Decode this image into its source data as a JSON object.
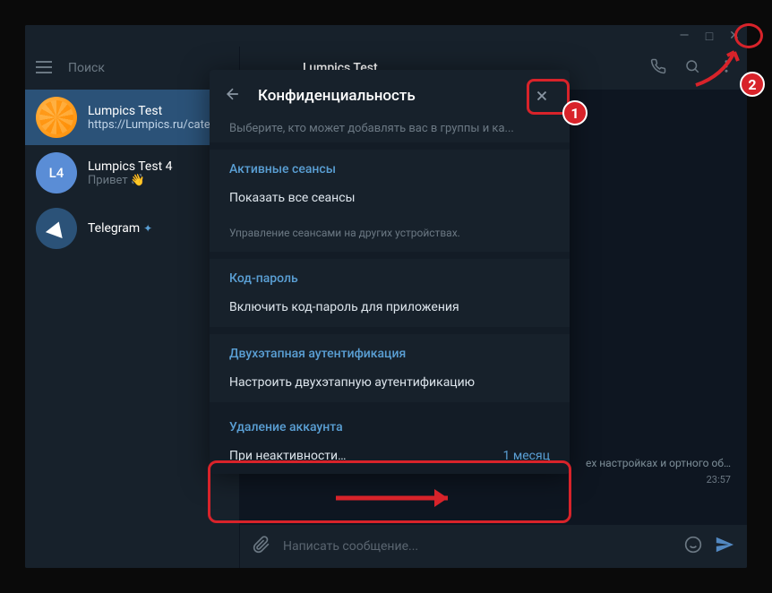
{
  "titlebar": {
    "minimize": "—",
    "maximize": "□",
    "close": "✕"
  },
  "sidebar": {
    "search_placeholder": "Поиск",
    "chats": [
      {
        "title": "Lumpics Test",
        "subtitle": "https://Lumpics.ru/cate...",
        "avatar_label": ""
      },
      {
        "title": "Lumpics Test 4",
        "subtitle": "Привет 👋",
        "avatar_label": "L4"
      },
      {
        "title": "Telegram",
        "subtitle": "",
        "verified": "✦"
      }
    ]
  },
  "chat": {
    "header_title": "Lumpics Test",
    "bg_message": "ех настройках и ортного об…",
    "time": "23:57",
    "composer_placeholder": "Написать сообщение..."
  },
  "settings": {
    "title": "Конфиденциальность",
    "truncated": "Выберите, кто может добавлять вас в группы и ка...",
    "sections": {
      "sessions": {
        "title": "Активные сеансы",
        "item": "Показать все сеансы",
        "hint": "Управление сеансами на других устройствах."
      },
      "passcode": {
        "title": "Код-пароль",
        "item": "Включить код-пароль для приложения"
      },
      "twofa": {
        "title": "Двухэтапная аутентификация",
        "item": "Настроить двухэтапную аутентификацию"
      },
      "deletion": {
        "title": "Удаление аккаунта",
        "label": "При неактивности…",
        "value": "1 месяц"
      }
    }
  },
  "annotations": {
    "badge1": "1",
    "badge2": "2"
  }
}
